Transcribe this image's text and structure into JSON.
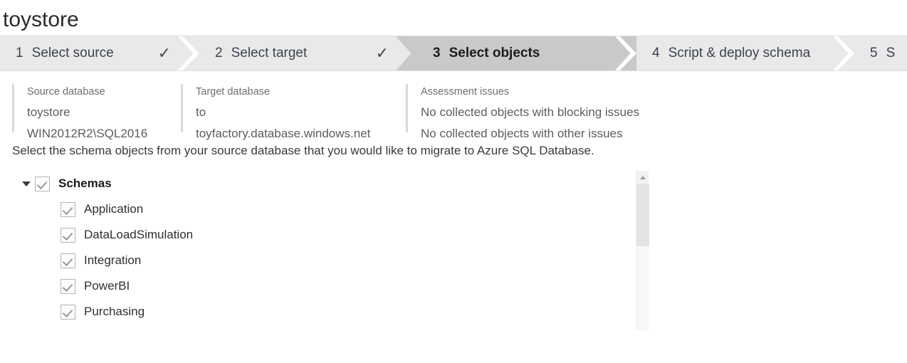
{
  "header": {
    "title": "toystore"
  },
  "wizard": {
    "steps": [
      {
        "num": "1",
        "label": "Select source",
        "state": "complete",
        "check": "✓"
      },
      {
        "num": "2",
        "label": "Select target",
        "state": "complete",
        "check": "✓"
      },
      {
        "num": "3",
        "label": "Select objects",
        "state": "active",
        "check": ""
      },
      {
        "num": "4",
        "label": "Script & deploy schema",
        "state": "upcoming",
        "check": ""
      },
      {
        "num": "5",
        "label": "S",
        "state": "upcoming",
        "check": ""
      }
    ]
  },
  "summary": {
    "source": {
      "heading": "Source database",
      "line1": "toystore",
      "line2": "WIN2012R2\\SQL2016"
    },
    "target": {
      "heading": "Target database",
      "line1": "to",
      "line2": "toyfactory.database.windows.net"
    },
    "assessment": {
      "heading": "Assessment issues",
      "line1": "No collected objects with blocking issues",
      "line2": "No collected objects with other issues"
    }
  },
  "main": {
    "instruction": "Select the schema objects from your source database that you would like to migrate to Azure SQL Database.",
    "tree": {
      "root": {
        "label": "Schemas",
        "checked": true,
        "expanded": true
      },
      "children": [
        {
          "label": "Application",
          "checked": true
        },
        {
          "label": "DataLoadSimulation",
          "checked": true
        },
        {
          "label": "Integration",
          "checked": true
        },
        {
          "label": "PowerBI",
          "checked": true
        },
        {
          "label": "Purchasing",
          "checked": true
        }
      ]
    },
    "scrollbar": {
      "up_arrow": "scroll-up-arrow"
    }
  },
  "colors": {
    "step_inactive_bg": "#e9e9e9",
    "step_active_bg": "#c9c9c9",
    "text_primary": "#2f2f2f",
    "text_muted": "#6e6e6e",
    "divider": "#d9d9d9"
  }
}
